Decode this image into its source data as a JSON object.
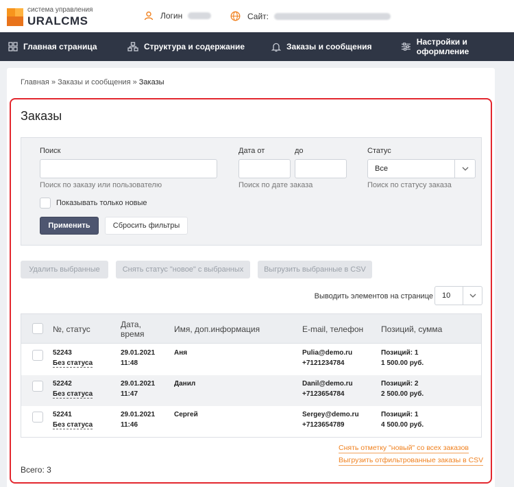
{
  "header": {
    "logo_small": "система управления",
    "logo_big": "URALCMS",
    "login_label": "Логин",
    "site_label": "Сайт:"
  },
  "nav": {
    "items": [
      {
        "label": "Главная страница",
        "icon": "grid-icon"
      },
      {
        "label": "Структура и содержание",
        "icon": "structure-icon"
      },
      {
        "label": "Заказы и сообщения",
        "icon": "bell-icon"
      },
      {
        "label": "Настройки и оформление",
        "icon": "sliders-icon"
      }
    ]
  },
  "breadcrumb": {
    "home": "Главная",
    "section": "Заказы и сообщения",
    "current": "Заказы",
    "sep": "»"
  },
  "page_title": "Заказы",
  "filter": {
    "search_label": "Поиск",
    "search_value": "",
    "search_hint": "Поиск по заказу или пользователю",
    "date_from_label": "Дата от",
    "date_to_label": "до",
    "date_hint": "Поиск по дате заказа",
    "status_label": "Статус",
    "status_value": "Все",
    "status_hint": "Поиск по статусу заказа",
    "only_new_label": "Показывать только новые",
    "apply_label": "Применить",
    "reset_label": "Сбросить фильтры"
  },
  "bulk_actions": {
    "delete_label": "Удалить выбранные",
    "unset_new_label": "Снять статус \"новое\" с выбранных",
    "export_label": "Выгрузить выбранные в CSV"
  },
  "per_page": {
    "label": "Выводить элементов на странице",
    "value": "10"
  },
  "table": {
    "headers": {
      "num_status": "№, статус",
      "date_line1": "Дата,",
      "date_line2": "время",
      "name": "Имя, доп.информация",
      "contact": "E-mail, телефон",
      "items_sum": "Позиций, сумма"
    },
    "rows": [
      {
        "num": "52243",
        "status": "Без статуса",
        "date": "29.01.2021",
        "time": "11:48",
        "name": "Аня",
        "email": "Pulia@demo.ru",
        "phone": "+7121234784",
        "items": "Позиций: 1",
        "sum": "1 500.00 руб."
      },
      {
        "num": "52242",
        "status": "Без статуса",
        "date": "29.01.2021",
        "time": "11:47",
        "name": "Данил",
        "email": "Danil@demo.ru",
        "phone": "+7123654784",
        "items": "Позиций: 2",
        "sum": "2 500.00 руб."
      },
      {
        "num": "52241",
        "status": "Без статуса",
        "date": "29.01.2021",
        "time": "11:46",
        "name": "Сергей",
        "email": "Sergey@demo.ru",
        "phone": "+7123654789",
        "items": "Позиций: 1",
        "sum": "4 500.00 руб."
      }
    ]
  },
  "footer_links": {
    "unmark_all": "Снять отметку \"новый\" со всех заказов",
    "export_filtered": "Выгрузить отфильтрованные заказы в CSV"
  },
  "total": "Всего: 3",
  "colors": {
    "accent": "#f0811f",
    "nav_bg": "#2f3645",
    "primary_button": "#4e5670",
    "highlight": "#e3262d"
  }
}
